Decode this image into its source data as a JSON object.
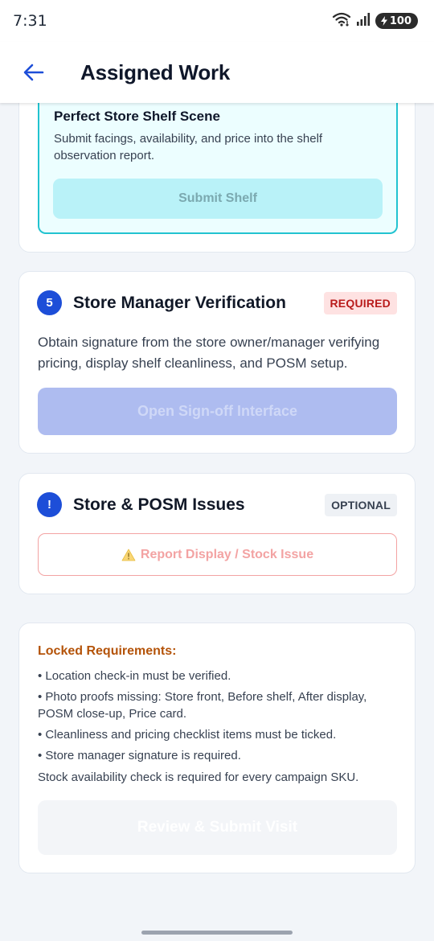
{
  "status_bar": {
    "time": "7:31",
    "battery": "100",
    "icons": [
      "wifi-icon",
      "signal-icon",
      "battery-icon"
    ]
  },
  "header": {
    "title": "Assigned Work",
    "back_icon": "arrow-left-icon"
  },
  "shelf_task": {
    "title": "Perfect Store Shelf Scene",
    "description": "Submit facings, availability, and price into the shelf observation report.",
    "button_label": "Submit Shelf"
  },
  "verification": {
    "step_number": "5",
    "title": "Store Manager Verification",
    "tag": "REQUIRED",
    "description": "Obtain signature from the store owner/manager verifying pricing, display shelf cleanliness, and POSM setup.",
    "button_label": "Open Sign-off Interface"
  },
  "issues": {
    "step_icon": "!",
    "title": "Store & POSM Issues",
    "tag": "OPTIONAL",
    "button_label": "Report Display / Stock Issue"
  },
  "locked": {
    "title": "Locked Requirements:",
    "items": [
      "• Location check-in must be verified.",
      "• Photo proofs missing: Store front, Before shelf, After display, POSM close-up, Price card.",
      "• Cleanliness and pricing checklist items must be ticked.",
      "• Store manager signature is required."
    ],
    "note": "Stock availability check is required for every campaign SKU.",
    "button_label": "Review & Submit Visit"
  },
  "colors": {
    "primary": "#1d4ed8",
    "accent_cyan": "#22c3d0",
    "required_red": "#b91c1c",
    "warning_orange": "#b45309"
  }
}
